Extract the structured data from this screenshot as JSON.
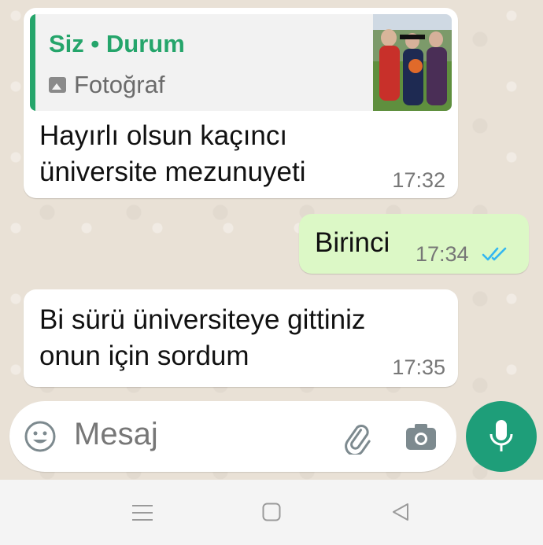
{
  "messages": [
    {
      "direction": "incoming",
      "quote": {
        "author": "Siz • Durum",
        "type_label": "Fotoğraf"
      },
      "text_line1": "Hayırlı olsun kaçıncı",
      "text_line2": "üniversite mezunuyeti",
      "time": "17:32"
    },
    {
      "direction": "outgoing",
      "text": "Birinci",
      "time": "17:34",
      "status": "read"
    },
    {
      "direction": "incoming",
      "text_line1": "Bi sürü üniversiteye gittiniz",
      "text_line2": "onun için sordum",
      "time": "17:35"
    }
  ],
  "composer": {
    "placeholder": "Mesaj",
    "icons": [
      "emoji-icon",
      "attach-icon",
      "camera-icon",
      "mic-icon"
    ]
  },
  "colors": {
    "chat_background": "#e9e1d6",
    "outgoing_bubble": "#dcf8c6",
    "incoming_bubble": "#ffffff",
    "quote_accent": "#25a56b",
    "read_ticks": "#34b7f1",
    "mic_button": "#1e9e79"
  },
  "navbar": {
    "buttons": [
      "menu-icon",
      "home-icon",
      "back-icon"
    ]
  }
}
